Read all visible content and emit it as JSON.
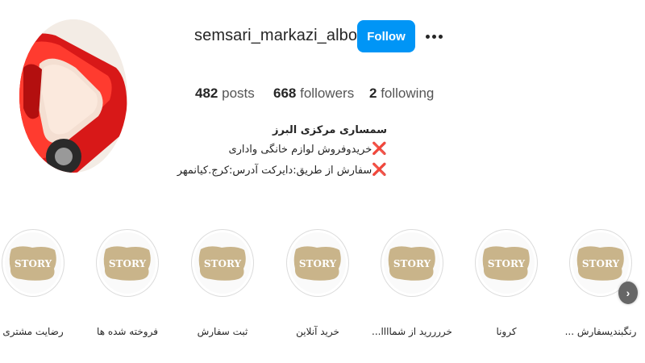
{
  "profile": {
    "username": "semsari_markazi_alborz",
    "follow_label": "Follow",
    "more_icon": "more-horizontal-icon",
    "avatar_alt": "red car bed"
  },
  "stats": {
    "posts": {
      "count": "482",
      "label": "posts"
    },
    "followers": {
      "count": "668",
      "label": "followers"
    },
    "following": {
      "count": "2",
      "label": "following"
    }
  },
  "bio": {
    "name": "سمساری مرکزی البرز",
    "lines": [
      {
        "icon": "❌",
        "text": "خریدوفروش لوازم خانگی واداری"
      },
      {
        "icon": "❌",
        "text": "سفارش از طریق:دایرکت آدرس:کرج.کیانمهر"
      }
    ]
  },
  "highlights": [
    {
      "label": "رضایت مشتری",
      "badge": "STORY"
    },
    {
      "label": "فروخته شده ها",
      "badge": "STORY"
    },
    {
      "label": "ثبت سفارش",
      "badge": "STORY"
    },
    {
      "label": "خرید آنلاین",
      "badge": "STORY"
    },
    {
      "label": "خررررید از شماااا...",
      "badge": "STORY"
    },
    {
      "label": "کرونا",
      "badge": "STORY"
    },
    {
      "label": "رنگبندیسفارش ...",
      "badge": "STORY"
    }
  ],
  "colors": {
    "follow_button": "#0095f6",
    "close_mark": "#e0245e",
    "story_badge": "#c9b48a"
  },
  "nav": {
    "next_icon": "chevron-right-icon",
    "next_glyph": "›"
  }
}
